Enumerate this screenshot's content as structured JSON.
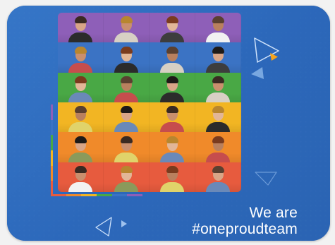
{
  "tagline": {
    "line1": "We are",
    "line2": "#oneproudteam"
  },
  "colors": {
    "background": "#2f6fc3",
    "accent_orange": "#f5a31b",
    "rows": [
      "#8e5fb8",
      "#3b73c4",
      "#49a845",
      "#f2b523",
      "#f08a2a",
      "#e75b3e"
    ],
    "rainbow": [
      "#8e5fb8",
      "#3b73c4",
      "#49a845",
      "#f2b523",
      "#f08a2a",
      "#e75b3e"
    ]
  },
  "photo_grid": {
    "rows": 6,
    "columns": 4
  },
  "icons": [
    "triangle-outline-icon",
    "triangle-orange-icon",
    "triangle-solid-icon",
    "paper-plane-icon"
  ]
}
